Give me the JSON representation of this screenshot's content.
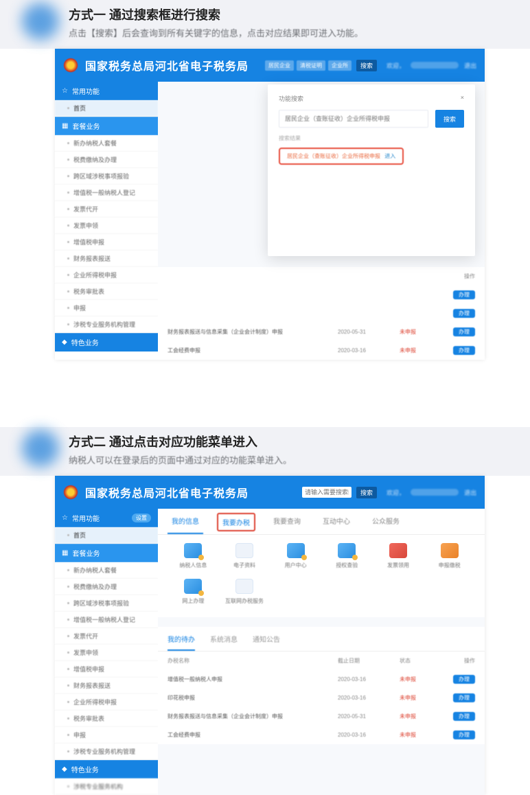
{
  "section1": {
    "title": "方式一 通过搜索框进行搜索",
    "desc": "点击【搜索】后会查询到所有关键字的信息，点击对应结果即可进入功能。"
  },
  "section2": {
    "title": "方式二 通过点击对应功能菜单进入",
    "desc": "纳税人可以在登录后的页面中通过对应的功能菜单进入。"
  },
  "app": {
    "title": "国家税务总局河北省电子税务局",
    "header_search_placeholder": "请输入需要搜索的内容",
    "header_search_tags": [
      "居民企业",
      "清税证明",
      "企业所"
    ],
    "header_search_btn": "搜索",
    "header_right": {
      "welcome": "欢迎，",
      "logout": "退出"
    }
  },
  "sidebar": {
    "cat1": "常用功能",
    "cat1_badge": "设置",
    "sub1": "首页",
    "cat2": "套餐业务",
    "items": [
      "新办纳税人套餐",
      "税费缴纳及办理",
      "跨区域涉税事项报验",
      "增值税一般纳税人登记",
      "发票代开",
      "发票申领",
      "增值税申报",
      "财务报表报送",
      "企业所得税申报",
      "税务审批表",
      "申报",
      "涉税专业服务机构管理"
    ],
    "cat3": "特色业务"
  },
  "nav_tabs": [
    "我的信息",
    "我要办税",
    "我要查询",
    "互动中心",
    "公众服务"
  ],
  "apps": [
    {
      "label": "纳税人信息",
      "cls": "ic-blue ic-after"
    },
    {
      "label": "电子资料",
      "cls": "ic-white"
    },
    {
      "label": "用户中心",
      "cls": "ic-blue ic-after"
    },
    {
      "label": "授权查验",
      "cls": "ic-blue ic-after"
    },
    {
      "label": "发票领用",
      "cls": "ic-red"
    },
    {
      "label": "申报缴税",
      "cls": "ic-orange"
    },
    {
      "label": "网上办理",
      "cls": "ic-blue ic-after"
    },
    {
      "label": "互联网办税服务",
      "cls": "ic-white"
    }
  ],
  "panel_tabs": [
    "我的待办",
    "系统消息",
    "通知公告"
  ],
  "table": {
    "headers": [
      "办税名称",
      "截止日期",
      "状态",
      "操作"
    ],
    "rows": [
      {
        "name": "增值税一般纳税人申报",
        "date": "2020-03-16",
        "status": "未申报",
        "action": "办理"
      },
      {
        "name": "印花税申报",
        "date": "2020-03-16",
        "status": "未申报",
        "action": "办理"
      },
      {
        "name": "财务报表报送与信息采集（企业会计制度）申报",
        "date": "2020-05-31",
        "status": "未申报",
        "action": "办理"
      },
      {
        "name": "工会经费申报",
        "date": "2020-03-16",
        "status": "未申报",
        "action": "办理"
      }
    ]
  },
  "modal": {
    "title": "功能搜索",
    "close": "×",
    "input_placeholder": "居民企业（查账征收）企业所得税申报",
    "btn": "搜索",
    "result_label": "搜索结果",
    "result_text": "居民企业（查账征收）企业所得税申报",
    "result_go": "进入"
  }
}
